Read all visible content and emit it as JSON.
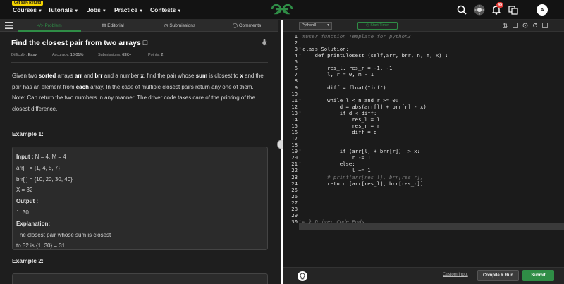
{
  "nav": {
    "promo": "Get 90% Refund",
    "items": [
      {
        "label": "Courses"
      },
      {
        "label": "Tutorials"
      },
      {
        "label": "Jobs"
      },
      {
        "label": "Practice"
      },
      {
        "label": "Contests"
      }
    ],
    "notif_count": "45",
    "avatar": "A"
  },
  "tabs": [
    "Problem",
    "Editorial",
    "Submissions",
    "Comments"
  ],
  "problem": {
    "title": "Find the closest pair from two arrays",
    "difficulty_label": "Difficulty:",
    "difficulty": "Easy",
    "accuracy_label": "Accuracy:",
    "accuracy": "18.01%",
    "submissions_label": "Submissions:",
    "submissions": "63K+",
    "points_label": "Points:",
    "points": "2",
    "desc": {
      "t1": "Given two ",
      "b1": "sorted",
      "t2": " arrays ",
      "b2": "arr",
      "t3": " and ",
      "b3": "brr",
      "t4": " and a number ",
      "b4": "x",
      "t5": ", find the pair whose ",
      "b5": "sum",
      "t6": " is closest to ",
      "b6": "x",
      "t7": " and the pair has an element from ",
      "b7": "each",
      "t8": " array. In the case of multiple closest pairs return any one of them.",
      "note": "Note: Can return the two numbers in any manner. The driver code takes care of the printing of the closest difference."
    },
    "ex1_title": "Example 1:",
    "ex1_lines": [
      {
        "k": "Input :",
        "v": " N = 4, M = 4"
      },
      {
        "k": "",
        "v": "arr[ ] = {1, 4, 5, 7}"
      },
      {
        "k": "",
        "v": "brr[ ] = {10, 20, 30, 40}"
      },
      {
        "k": "",
        "v": "X = 32"
      },
      {
        "k": "Output :",
        "v": ""
      },
      {
        "k": "",
        "v": "1, 30"
      },
      {
        "k": "Explanation:",
        "v": ""
      },
      {
        "k": "",
        "v": "The closest pair whose sum is closest"
      },
      {
        "k": "",
        "v": "to 32 is {1, 30} = 31."
      }
    ],
    "ex2_title": "Example 2:"
  },
  "editor": {
    "language": "Python3",
    "timer": "Start Timer",
    "lines": [
      {
        "n": "1",
        "t": "#User function Template for python3",
        "c": true
      },
      {
        "n": "2",
        "t": ""
      },
      {
        "n": "3",
        "t": "class Solution:",
        "f": true
      },
      {
        "n": "4",
        "t": "    def printClosest (self,arr, brr, n, m, x) :",
        "f": true
      },
      {
        "n": "5",
        "t": ""
      },
      {
        "n": "6",
        "t": "        res_l, res_r = -1, -1"
      },
      {
        "n": "7",
        "t": "        l, r = 0, m - 1"
      },
      {
        "n": "8",
        "t": ""
      },
      {
        "n": "9",
        "t": "        diff = float(\"inf\")"
      },
      {
        "n": "10",
        "t": ""
      },
      {
        "n": "11",
        "t": "        while l < n and r >= 0:",
        "f": true
      },
      {
        "n": "12",
        "t": "            d = abs(arr[l] + brr[r] - x)"
      },
      {
        "n": "13",
        "t": "            if d < diff:",
        "f": true
      },
      {
        "n": "14",
        "t": "                res_l = l"
      },
      {
        "n": "15",
        "t": "                res_r = r"
      },
      {
        "n": "16",
        "t": "                diff = d"
      },
      {
        "n": "17",
        "t": ""
      },
      {
        "n": "18",
        "t": ""
      },
      {
        "n": "19",
        "t": "            if (arr[l] + brr[r])  > x:",
        "f": true
      },
      {
        "n": "20",
        "t": "                r -= 1"
      },
      {
        "n": "21",
        "t": "            else:",
        "f": true
      },
      {
        "n": "22",
        "t": "                l += 1"
      },
      {
        "n": "23",
        "t": "        # print(arr[res_l], brr[res_r])",
        "c": true
      },
      {
        "n": "24",
        "t": "        return [arr[res_l], brr[res_r]]"
      },
      {
        "n": "25",
        "t": ""
      },
      {
        "n": "26",
        "t": ""
      },
      {
        "n": "27",
        "t": ""
      },
      {
        "n": "28",
        "t": ""
      },
      {
        "n": "29",
        "t": ""
      },
      {
        "n": "30",
        "t": "↔ } Driver Code Ends",
        "c": true,
        "f": true
      }
    ],
    "custom_input": "Custom Input",
    "compile_run": "Compile & Run",
    "submit": "Submit"
  }
}
